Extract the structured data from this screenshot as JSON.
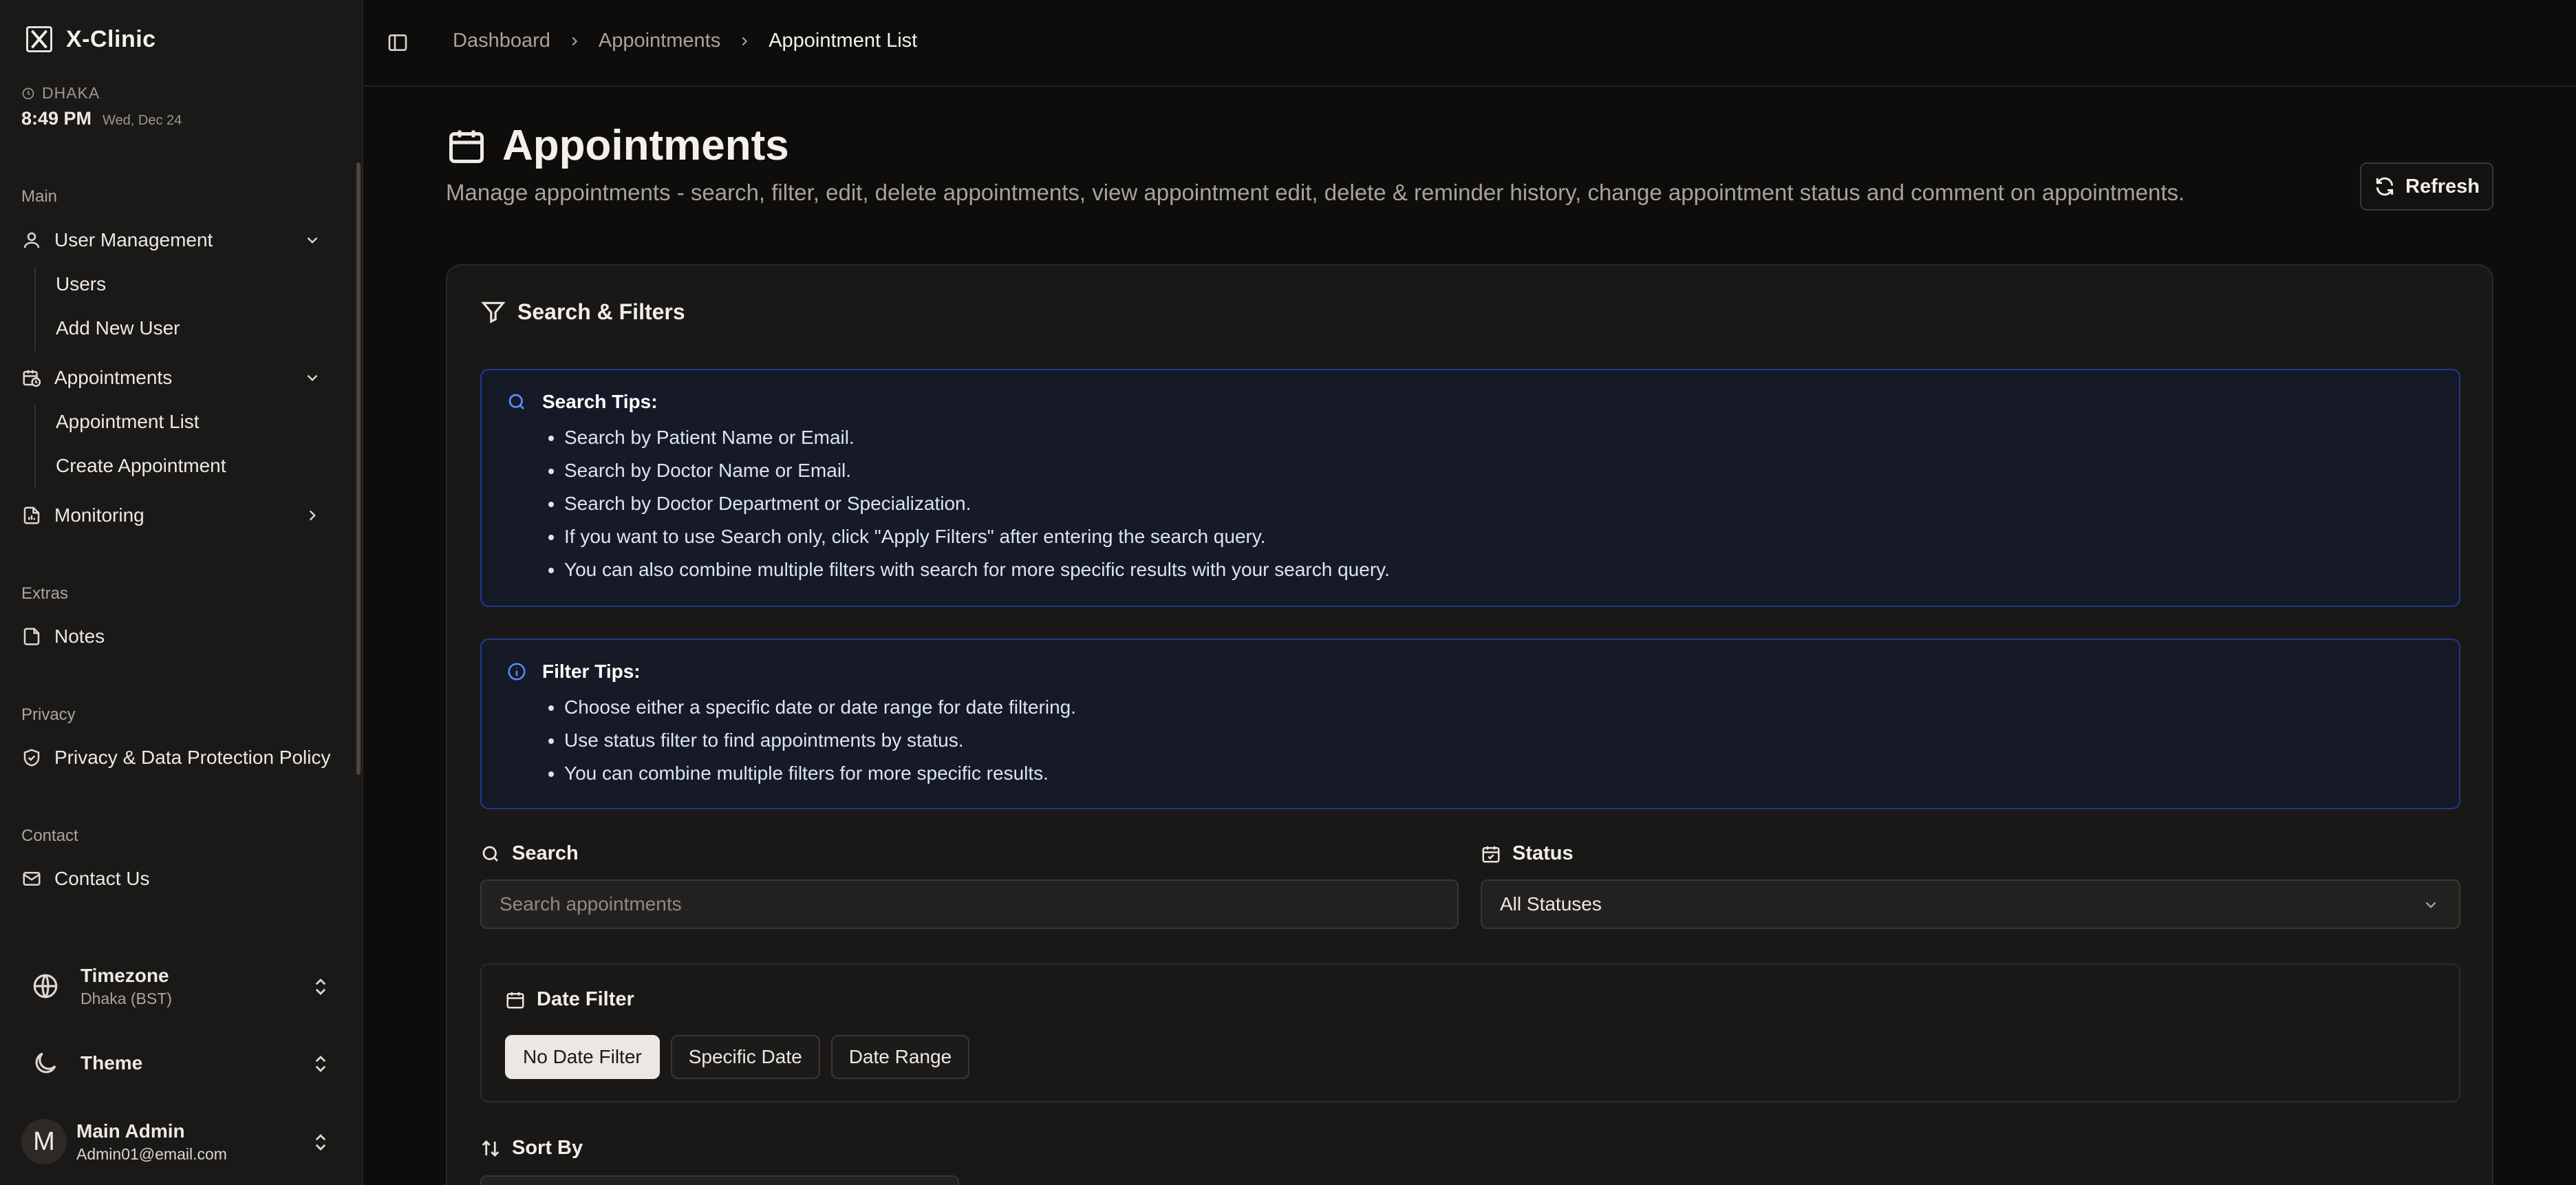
{
  "brand": {
    "name": "X-Clinic"
  },
  "clock": {
    "city": "DHAKA",
    "time": "8:49 PM",
    "date": "Wed, Dec 24"
  },
  "sidebar": {
    "sections": {
      "main": "Main",
      "extras": "Extras",
      "privacy": "Privacy",
      "contact": "Contact"
    },
    "user_management": {
      "label": "User Management",
      "children": [
        "Users",
        "Add New User"
      ]
    },
    "appointments": {
      "label": "Appointments",
      "children": [
        "Appointment List",
        "Create Appointment"
      ]
    },
    "monitoring": {
      "label": "Monitoring"
    },
    "notes": {
      "label": "Notes"
    },
    "privacy_policy": {
      "label": "Privacy & Data Protection Policy"
    },
    "contact_us": {
      "label": "Contact Us"
    },
    "timezone": {
      "title": "Timezone",
      "value": "Dhaka (BST)"
    },
    "theme": {
      "title": "Theme"
    },
    "user": {
      "initial": "M",
      "name": "Main Admin",
      "email": "Admin01@email.com"
    }
  },
  "breadcrumb": [
    "Dashboard",
    "Appointments",
    "Appointment List"
  ],
  "page": {
    "title": "Appointments",
    "description": "Manage appointments - search, filter, edit, delete appointments, view appointment edit, delete & reminder history, change appointment status and comment on appointments.",
    "refresh_label": "Refresh"
  },
  "filters": {
    "title": "Search & Filters",
    "search_tips": {
      "title": "Search Tips:",
      "items": [
        "Search by Patient Name or Email.",
        "Search by Doctor Name or Email.",
        "Search by Doctor Department or Specialization.",
        "If you want to use Search only, click \"Apply Filters\" after entering the search query.",
        "You can also combine multiple filters with search for more specific results with your search query."
      ]
    },
    "filter_tips": {
      "title": "Filter Tips:",
      "items": [
        "Choose either a specific date or date range for date filtering.",
        "Use status filter to find appointments by status.",
        "You can combine multiple filters for more specific results."
      ]
    },
    "search": {
      "label": "Search",
      "placeholder": "Search appointments",
      "value": ""
    },
    "status": {
      "label": "Status",
      "value": "All Statuses"
    },
    "date_filter": {
      "label": "Date Filter",
      "options": [
        "No Date Filter",
        "Specific Date",
        "Date Range"
      ],
      "selected": "No Date Filter"
    },
    "sort": {
      "label": "Sort By"
    }
  },
  "colors": {
    "accent_blue": "#5b8cff",
    "tips_border": "#1f3a8f",
    "background": "#0e0d0c",
    "sidebar_bg": "#1b1917"
  }
}
